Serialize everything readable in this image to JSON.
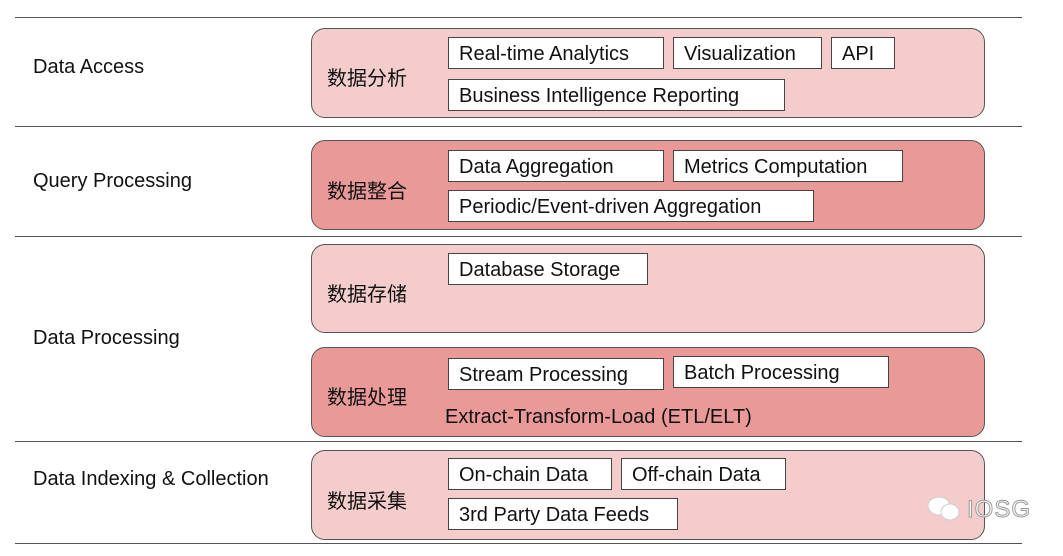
{
  "layers": [
    {
      "label": "Data Access",
      "modules": [
        {
          "title": "数据分析",
          "items": [
            "Real-time Analytics",
            "Visualization",
            "API",
            "Business Intelligence Reporting"
          ]
        }
      ]
    },
    {
      "label": "Query Processing",
      "modules": [
        {
          "title": "数据整合",
          "items": [
            "Data Aggregation",
            "Metrics Computation",
            "Periodic/Event-driven Aggregation"
          ]
        }
      ]
    },
    {
      "label": "Data Processing",
      "modules": [
        {
          "title": "数据存储",
          "items": [
            "Database Storage"
          ]
        },
        {
          "title": "数据处理",
          "items": [
            "Stream Processing",
            "Batch Processing"
          ],
          "note": "Extract-Transform-Load (ETL/ELT)"
        }
      ]
    },
    {
      "label": "Data Indexing & Collection",
      "modules": [
        {
          "title": "数据采集",
          "items": [
            "On-chain Data",
            "Off-chain Data",
            "3rd Party Data Feeds"
          ]
        }
      ]
    }
  ],
  "watermark": "IOSG",
  "colors": {
    "light": "#f4cccc",
    "dark": "#ea9999"
  }
}
